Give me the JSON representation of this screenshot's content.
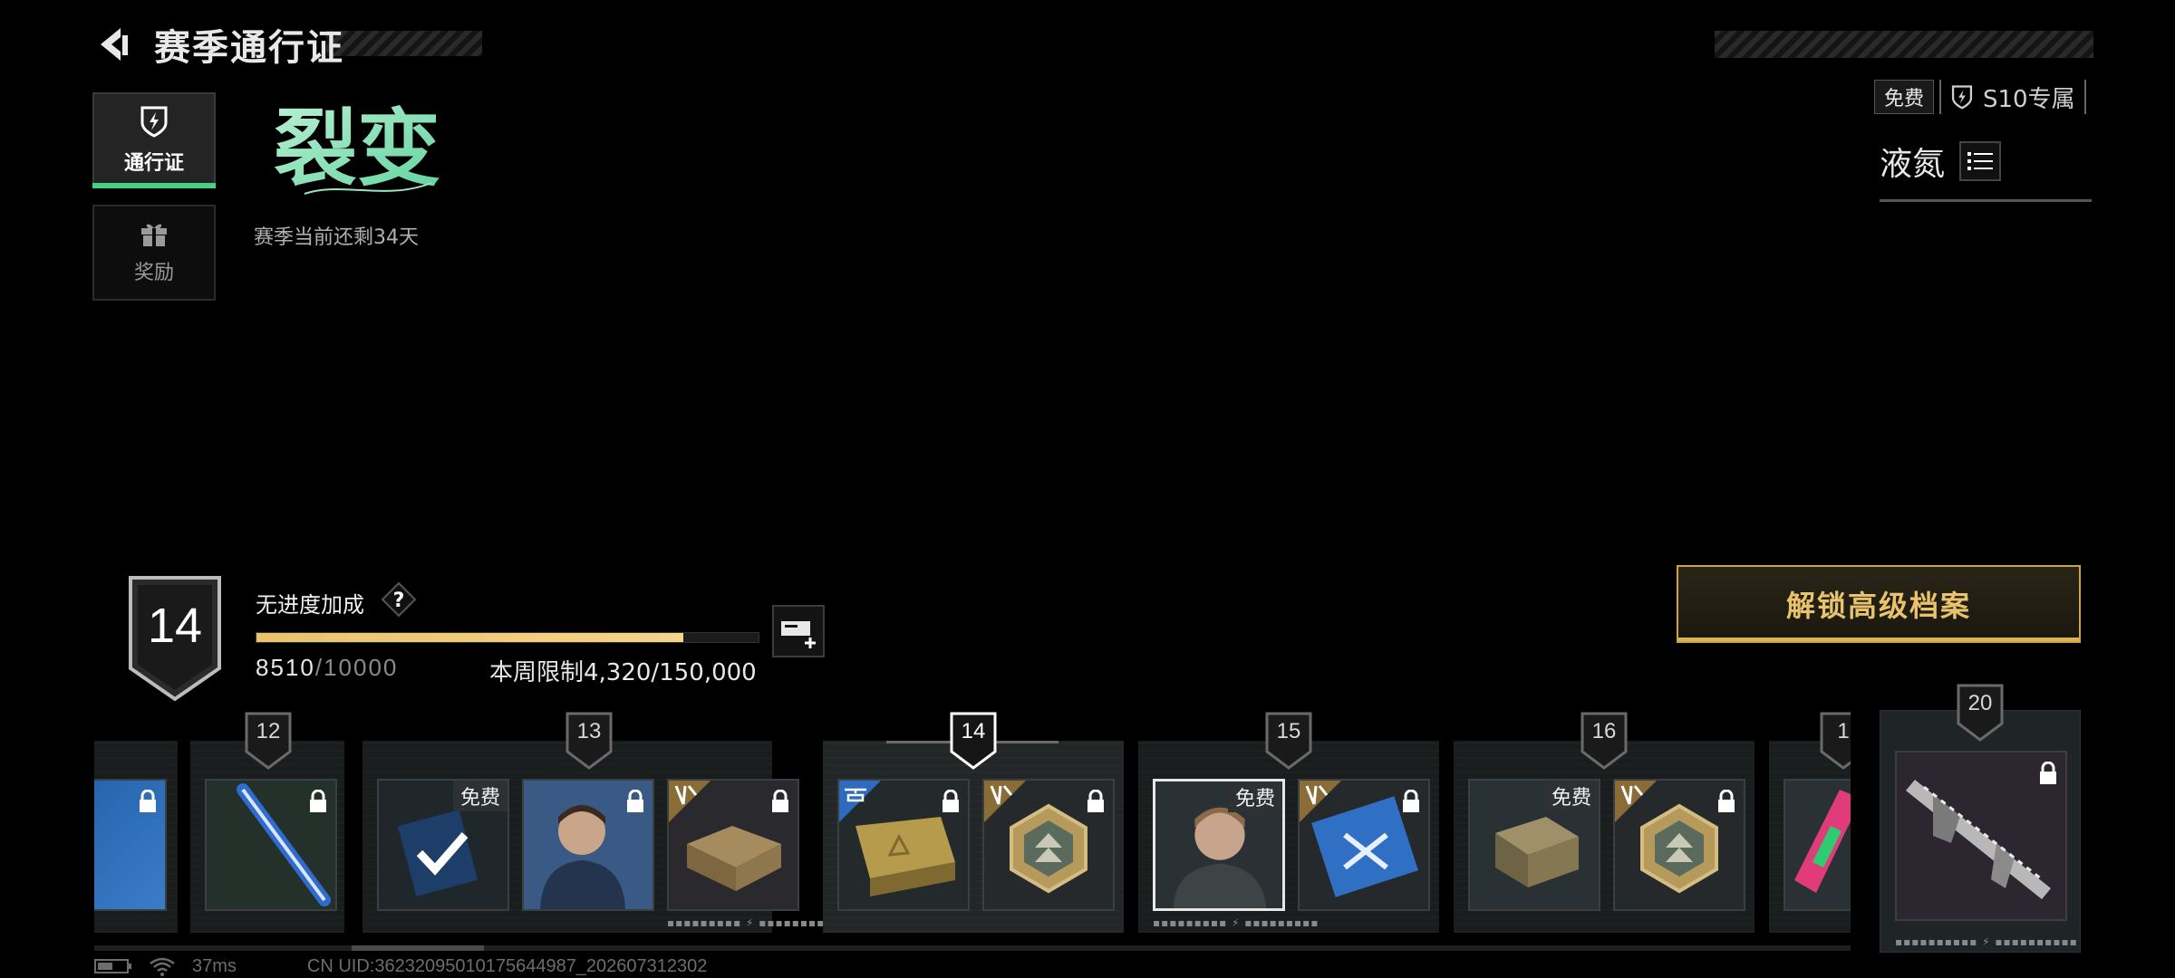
{
  "header": {
    "title": "赛季通行证"
  },
  "sidebar": {
    "items": [
      {
        "label": "通行证",
        "icon": "pass-shield-icon",
        "active": true
      },
      {
        "label": "奖励",
        "icon": "gift-icon",
        "active": false
      }
    ]
  },
  "season": {
    "logo_text": "裂变",
    "remaining": "赛季当前还剩34天",
    "name": "液氮",
    "chips": {
      "free": "免费",
      "exclusive": "S10专属"
    }
  },
  "progress": {
    "level": "14",
    "bonus_label": "无进度加成",
    "help": "?",
    "current": "8510",
    "max": "/10000",
    "fraction": 0.851,
    "weekly_limit": "本周限制4,320/150,000"
  },
  "unlock_button": "解锁高级档案",
  "track": {
    "levels": [
      "12",
      "13",
      "14",
      "15",
      "16",
      "1",
      "20"
    ],
    "free_label": "免费",
    "cards": [
      {
        "type": "ticket-blue",
        "free": false
      },
      {
        "type": "sniper-blue",
        "free": false
      },
      {
        "type": "checkmark-card",
        "free": true
      },
      {
        "type": "operator-portrait",
        "free": false
      },
      {
        "type": "weapon-case",
        "free": false
      },
      {
        "type": "supply-crate",
        "free": false
      },
      {
        "type": "emblem-gold",
        "free": false
      },
      {
        "type": "operator-portrait-2",
        "free": true
      },
      {
        "type": "ticket-blue",
        "free": false
      },
      {
        "type": "ammo-box",
        "free": true
      },
      {
        "type": "emblem-gold",
        "free": false
      },
      {
        "type": "colorful-item",
        "free": false
      },
      {
        "type": "rifle-skin",
        "free": false
      }
    ]
  },
  "status": {
    "ping": "37ms",
    "uid": "CN UID:36232095010175644987_202607312302"
  },
  "colors": {
    "accent_green": "#46d083",
    "gold": "#e8c36b",
    "xp_bar": "#f6d488"
  }
}
